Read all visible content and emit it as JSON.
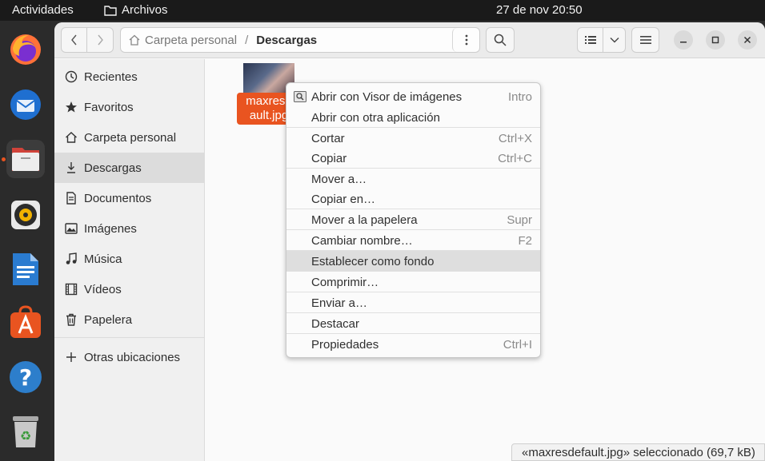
{
  "topbar": {
    "activities": "Actividades",
    "app_name": "Archivos",
    "clock": "27 de nov  20:50"
  },
  "dock": {
    "items": [
      "firefox-icon",
      "thunderbird-icon",
      "files-icon",
      "rhythmbox-icon",
      "libreoffice-writer-icon",
      "app-center-icon",
      "help-icon",
      "trash-icon"
    ]
  },
  "header": {
    "path_home": "Carpeta personal",
    "path_separator": "/",
    "path_current": "Descargas"
  },
  "sidebar": {
    "items": [
      {
        "label": "Recientes",
        "icon": "clock-icon"
      },
      {
        "label": "Favoritos",
        "icon": "star-icon"
      },
      {
        "label": "Carpeta personal",
        "icon": "home-icon"
      },
      {
        "label": "Descargas",
        "icon": "download-icon"
      },
      {
        "label": "Documentos",
        "icon": "document-icon"
      },
      {
        "label": "Imágenes",
        "icon": "image-icon"
      },
      {
        "label": "Música",
        "icon": "music-icon"
      },
      {
        "label": "Vídeos",
        "icon": "video-icon"
      },
      {
        "label": "Papelera",
        "icon": "trash-icon"
      }
    ],
    "other_locations": "Otras ubicaciones"
  },
  "file": {
    "label_line1": "maxresd",
    "label_line2": "ault.jpg"
  },
  "context_menu": {
    "items": [
      {
        "label": "Abrir con Visor de imágenes",
        "accel": "Intro"
      },
      {
        "label": "Abrir con otra aplicación",
        "accel": ""
      },
      {
        "label": "Cortar",
        "accel": "Ctrl+X"
      },
      {
        "label": "Copiar",
        "accel": "Ctrl+C"
      },
      {
        "label": "Mover a…",
        "accel": ""
      },
      {
        "label": "Copiar en…",
        "accel": ""
      },
      {
        "label": "Mover a la papelera",
        "accel": "Supr"
      },
      {
        "label": "Cambiar nombre…",
        "accel": "F2"
      },
      {
        "label": "Establecer como fondo",
        "accel": ""
      },
      {
        "label": "Comprimir…",
        "accel": ""
      },
      {
        "label": "Enviar a…",
        "accel": ""
      },
      {
        "label": "Destacar",
        "accel": ""
      },
      {
        "label": "Propiedades",
        "accel": "Ctrl+I"
      }
    ]
  },
  "statusbar": {
    "text": "«maxresdefault.jpg» seleccionado (69,7 kB)"
  },
  "colors": {
    "accent": "#e95420",
    "selection": "#dcdcdc"
  }
}
